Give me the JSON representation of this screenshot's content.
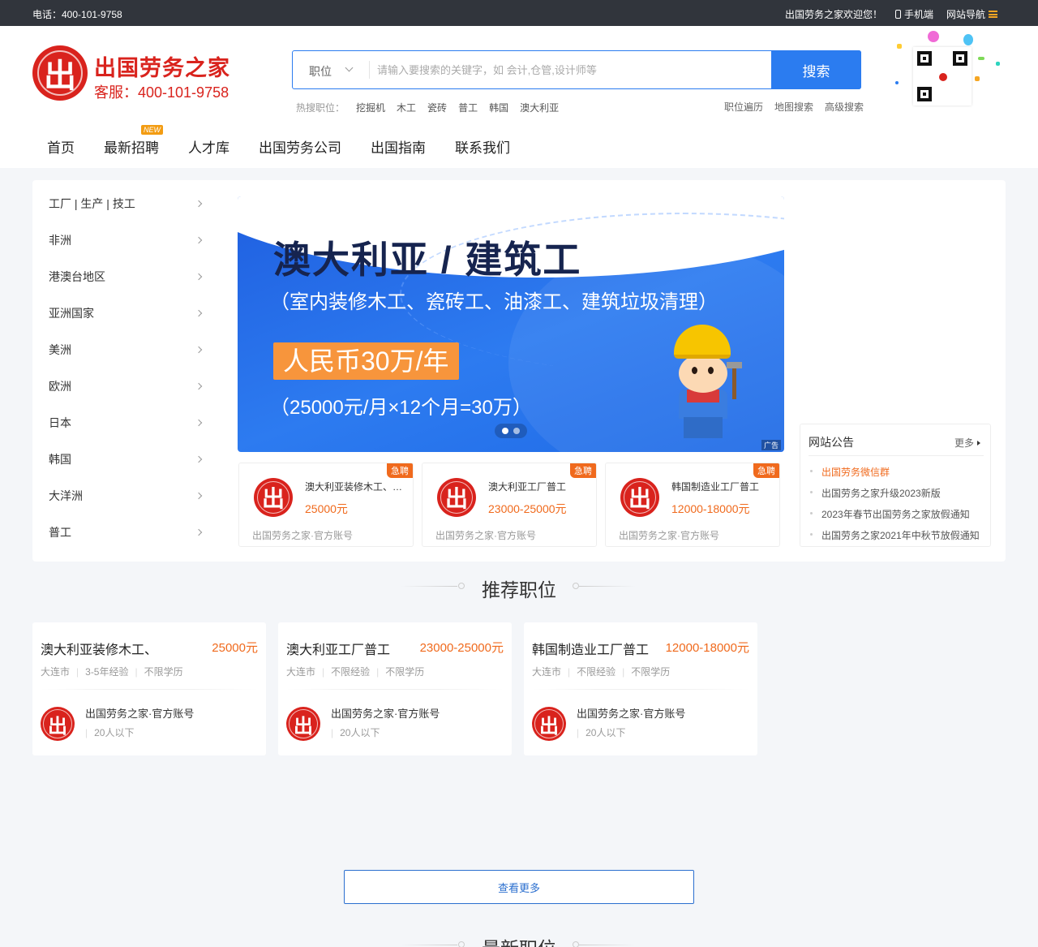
{
  "topbar": {
    "phone": "电话：400-101-9758",
    "welcome": "出国劳务之家欢迎您！",
    "mobile": "手机端",
    "site_nav": "网站导航"
  },
  "logo": {
    "mark": "出",
    "name": "出国劳务之家",
    "service": "客服：400-101-9758"
  },
  "search": {
    "category": "职位",
    "placeholder": "请输入要搜索的关键字，如 会计,仓管,设计师等",
    "button": "搜索"
  },
  "hot": {
    "label": "热搜职位：",
    "keywords": [
      "挖掘机",
      "木工",
      "瓷砖",
      "普工",
      "韩国",
      "澳大利亚"
    ]
  },
  "quick_links": [
    "职位遍历",
    "地图搜索",
    "高级搜索"
  ],
  "nav": {
    "items": [
      "首页",
      "最新招聘",
      "人才库",
      "出国劳务公司",
      "出国指南",
      "联系我们"
    ],
    "new_badge": "NEW"
  },
  "categories": [
    "工厂 | 生产 | 技工",
    "非洲",
    "港澳台地区",
    "亚洲国家",
    "美洲",
    "欧洲",
    "日本",
    "韩国",
    "大洋洲",
    "普工"
  ],
  "banner": {
    "title": "澳大利亚 / 建筑工",
    "subtitle": "（室内装修木工、瓷砖工、油漆工、建筑垃圾清理）",
    "price": "人民币30万/年",
    "detail": "（25000元/月×12个月=30万）",
    "ad": "广告"
  },
  "urgent_jobs": [
    {
      "badge": "急聘",
      "title": "澳大利亚装修木工、瓷砖工",
      "salary": "25000元",
      "company": "出国劳务之家·官方账号"
    },
    {
      "badge": "急聘",
      "title": "澳大利亚工厂普工",
      "salary": "23000-25000元",
      "company": "出国劳务之家·官方账号"
    },
    {
      "badge": "急聘",
      "title": "韩国制造业工厂普工",
      "salary": "12000-18000元",
      "company": "出国劳务之家·官方账号"
    }
  ],
  "notice": {
    "title": "网站公告",
    "more": "更多",
    "items": [
      "出国劳务微信群",
      "出国劳务之家升级2023新版",
      "2023年春节出国劳务之家放假通知",
      "出国劳务之家2021年中秋节放假通知"
    ]
  },
  "recommended": {
    "title": "推荐职位",
    "jobs": [
      {
        "title": "澳大利亚装修木工、",
        "salary": "25000元",
        "tags": [
          "大连市",
          "3-5年经验",
          "不限学历"
        ],
        "company": "出国劳务之家·官方账号",
        "size": "20人以下"
      },
      {
        "title": "澳大利亚工厂普工",
        "salary": "23000-25000元",
        "tags": [
          "大连市",
          "不限经验",
          "不限学历"
        ],
        "company": "出国劳务之家·官方账号",
        "size": "20人以下"
      },
      {
        "title": "韩国制造业工厂普工",
        "salary": "12000-18000元",
        "tags": [
          "大连市",
          "不限经验",
          "不限学历"
        ],
        "company": "出国劳务之家·官方账号",
        "size": "20人以下"
      }
    ],
    "more_button": "查看更多"
  },
  "latest": {
    "title": "最新职位"
  },
  "colors": {
    "brand_red": "#d9231d",
    "accent_blue": "#2b7cf0",
    "salary_orange": "#f06a1d",
    "topbar": "#31353c"
  }
}
